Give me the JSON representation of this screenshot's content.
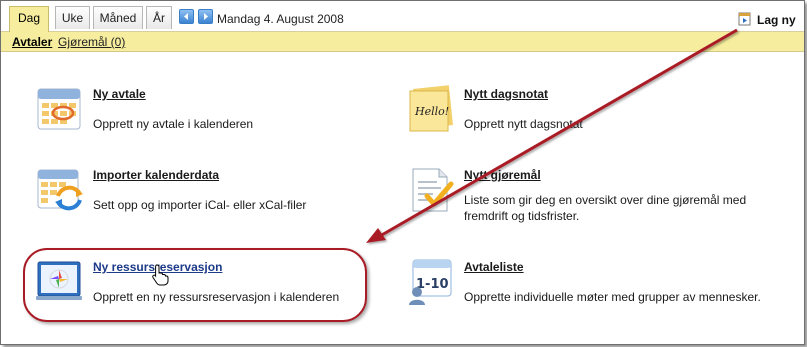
{
  "toolbar": {
    "tabs": [
      {
        "label": "Dag",
        "active": true
      },
      {
        "label": "Uke",
        "active": false
      },
      {
        "label": "Måned",
        "active": false
      },
      {
        "label": "År",
        "active": false
      }
    ],
    "prev_icon": "arrow-left-icon",
    "next_icon": "arrow-right-icon",
    "date": "Mandag 4. August 2008",
    "new_label": "Lag ny",
    "new_icon": "new-item-icon"
  },
  "subbar": {
    "links": [
      {
        "label": "Avtaler",
        "active": true
      },
      {
        "label": "Gjøremål (0)",
        "active": false
      }
    ]
  },
  "items": [
    {
      "title": "Ny avtale",
      "desc": "Opprett ny avtale i kalenderen",
      "icon": "calendar-icon"
    },
    {
      "title": "Nytt dagsnotat",
      "desc": "Opprett nytt dagsnotat",
      "icon": "sticky-note-icon",
      "icon_text": "Hello!"
    },
    {
      "title": "Importer kalenderdata",
      "desc": "Sett opp og importer iCal- eller xCal-filer",
      "icon": "calendar-import-icon"
    },
    {
      "title": "Nytt gjøremål",
      "desc": "Liste som gir deg en oversikt over dine gjøremål med fremdrift og tidsfrister.",
      "icon": "checklist-icon"
    },
    {
      "title": "Ny ressursreservasjon",
      "desc": "Opprett en ny ressursreservasjon i kalenderen",
      "icon": "resource-booking-icon"
    },
    {
      "title": "Avtaleliste",
      "desc": "Opprette individuelle møter med grupper av mennesker.",
      "icon": "appointment-list-icon",
      "icon_text": "1-10"
    }
  ],
  "annotation": {
    "color": "#a91c26"
  }
}
